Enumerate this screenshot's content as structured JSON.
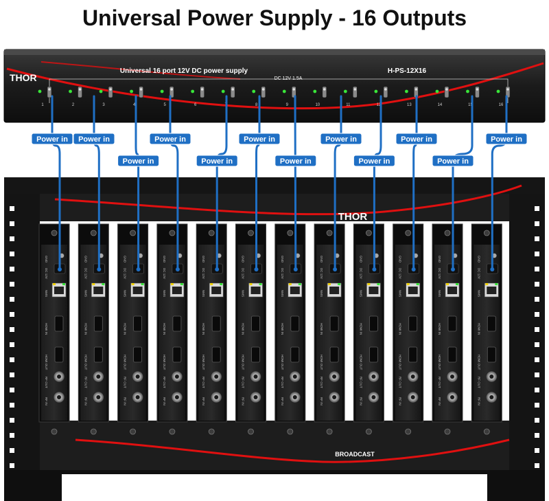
{
  "title": "Universal Power Supply - 16 Outputs",
  "psu": {
    "brand": "THOR",
    "label": "Universal 16 port 12V DC power supply",
    "model": "H-PS-12X16",
    "rating": "DC 12V 1.5A",
    "port_numbers": [
      "1",
      "2",
      "3",
      "4",
      "5",
      "6",
      "7",
      "8",
      "9",
      "10",
      "11",
      "12",
      "13",
      "14",
      "15",
      "16"
    ]
  },
  "chassis": {
    "brand_top": "THOR",
    "brand_bottom": "BROADCAST"
  },
  "card_labels": [
    "GND",
    "DC 12V",
    "NMS",
    "HDMI IN",
    "HDMI OUT",
    "RF OUT",
    "RF IN"
  ],
  "cables": [
    {
      "label": "Power in",
      "row": 1
    },
    {
      "label": "Power in",
      "row": 1
    },
    {
      "label": "Power in",
      "row": 2
    },
    {
      "label": "Power in",
      "row": 1
    },
    {
      "label": "Power in",
      "row": 2
    },
    {
      "label": "Power in",
      "row": 1
    },
    {
      "label": "Power in",
      "row": 2
    },
    {
      "label": "Power in",
      "row": 1
    },
    {
      "label": "Power in",
      "row": 2
    },
    {
      "label": "Power in",
      "row": 1
    },
    {
      "label": "Power in",
      "row": 2
    },
    {
      "label": "Power in",
      "row": 1
    }
  ],
  "colors": {
    "cable": "#1f6fc4",
    "label_bg": "#1f6fc4",
    "label_text": "#ffffff",
    "accent_red": "#e01010",
    "led_green": "#39e639",
    "metal": "#1a1a1a"
  }
}
